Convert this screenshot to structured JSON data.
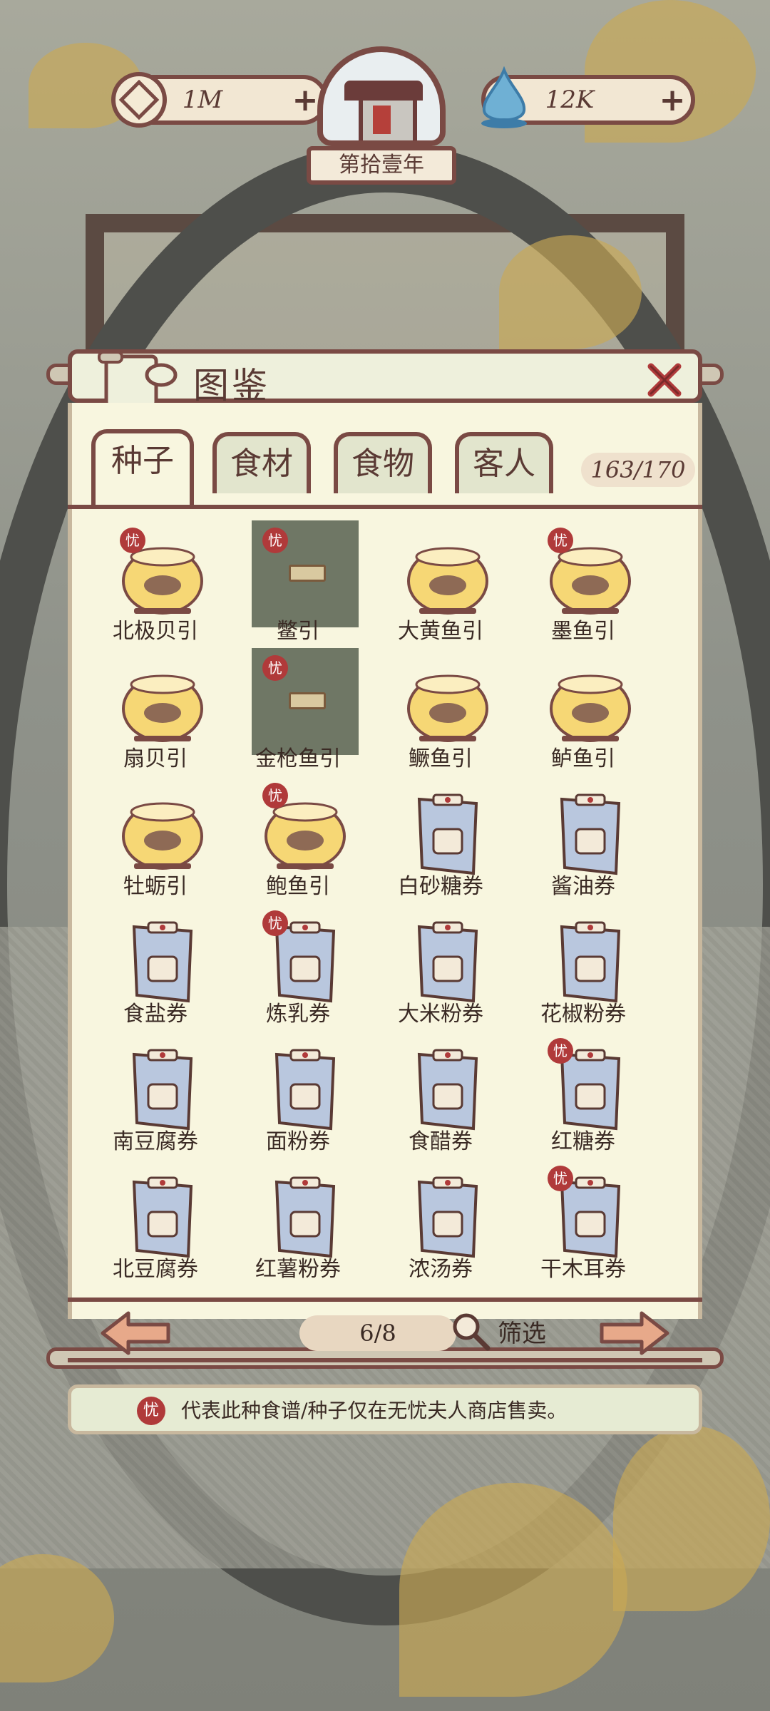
{
  "hud": {
    "coins": "1M",
    "water": "12K",
    "year": "第拾壹年"
  },
  "panel": {
    "title": "图鉴",
    "tabs": [
      "种子",
      "食材",
      "食物",
      "客人"
    ],
    "active_tab": 0,
    "count": "163/170"
  },
  "items": [
    {
      "label": "北极贝引",
      "badge": true,
      "kind": "bowl",
      "locked": false
    },
    {
      "label": "鳖引",
      "badge": true,
      "kind": "bowl",
      "locked": true
    },
    {
      "label": "大黄鱼引",
      "badge": false,
      "kind": "bowl",
      "locked": false
    },
    {
      "label": "墨鱼引",
      "badge": true,
      "kind": "bowl",
      "locked": false
    },
    {
      "label": "扇贝引",
      "badge": false,
      "kind": "bowl",
      "locked": false
    },
    {
      "label": "金枪鱼引",
      "badge": true,
      "kind": "bowl",
      "locked": true
    },
    {
      "label": "鳜鱼引",
      "badge": false,
      "kind": "bowl",
      "locked": false
    },
    {
      "label": "鲈鱼引",
      "badge": false,
      "kind": "bowl",
      "locked": false
    },
    {
      "label": "牡蛎引",
      "badge": false,
      "kind": "bowl",
      "locked": false
    },
    {
      "label": "鲍鱼引",
      "badge": true,
      "kind": "bowl",
      "locked": false
    },
    {
      "label": "白砂糖券",
      "badge": false,
      "kind": "ticket",
      "locked": false
    },
    {
      "label": "酱油券",
      "badge": false,
      "kind": "ticket",
      "locked": false
    },
    {
      "label": "食盐券",
      "badge": false,
      "kind": "ticket",
      "locked": false
    },
    {
      "label": "炼乳券",
      "badge": true,
      "kind": "ticket",
      "locked": false
    },
    {
      "label": "大米粉券",
      "badge": false,
      "kind": "ticket",
      "locked": false
    },
    {
      "label": "花椒粉券",
      "badge": false,
      "kind": "ticket",
      "locked": false
    },
    {
      "label": "南豆腐券",
      "badge": false,
      "kind": "ticket",
      "locked": false
    },
    {
      "label": "面粉券",
      "badge": false,
      "kind": "ticket",
      "locked": false
    },
    {
      "label": "食醋券",
      "badge": false,
      "kind": "ticket",
      "locked": false
    },
    {
      "label": "红糖券",
      "badge": true,
      "kind": "ticket",
      "locked": false
    },
    {
      "label": "北豆腐券",
      "badge": false,
      "kind": "ticket",
      "locked": false
    },
    {
      "label": "红薯粉券",
      "badge": false,
      "kind": "ticket",
      "locked": false
    },
    {
      "label": "浓汤券",
      "badge": false,
      "kind": "ticket",
      "locked": false
    },
    {
      "label": "干木耳券",
      "badge": true,
      "kind": "ticket",
      "locked": false
    }
  ],
  "badge_char": "忧",
  "pagination": {
    "page": "6/8",
    "filter": "筛选"
  },
  "note": "代表此种食谱/种子仅在无忧夫人商店售卖。",
  "colors": {
    "frame": "#7a4a44",
    "paper": "#f8f6df",
    "badge": "#b03a3a"
  }
}
